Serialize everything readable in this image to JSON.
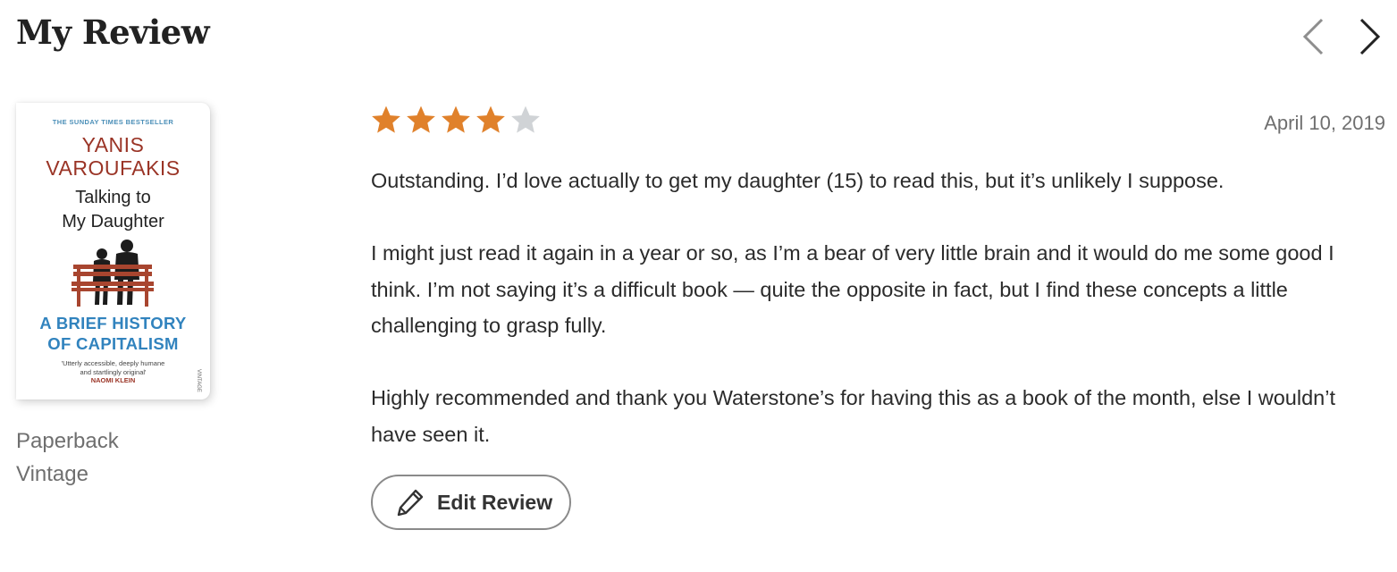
{
  "section": {
    "title": "My Review"
  },
  "navigation": {
    "prev_icon": "chevron-left-icon",
    "next_icon": "chevron-right-icon"
  },
  "book": {
    "cover": {
      "bestseller_line": "THE SUNDAY TIMES BESTSELLER",
      "author_line1": "YANIS",
      "author_line2": "VAROUFAKIS",
      "title_line1": "Talking to",
      "title_line2": "My Daughter",
      "subtitle_line1": "A BRIEF HISTORY",
      "subtitle_line2": "OF CAPITALISM",
      "quote_line1": "'Utterly accessible, deeply humane",
      "quote_line2": "and startlingly original'",
      "quote_author": "NAOMI KLEIN",
      "publisher_mark": "VINTAGE"
    },
    "format": "Paperback",
    "publisher": "Vintage"
  },
  "review": {
    "rating": 4,
    "max_rating": 5,
    "colors": {
      "star_filled": "#e0812b",
      "star_empty": "#d0d3d6"
    },
    "date": "April 10, 2019",
    "paragraphs": [
      "Outstanding. I’d love actually to get my daughter (15) to read this, but it’s unlikely I suppose.",
      "I might just read it again in a year or so, as I’m a bear of very little brain and it would do me some good I think. I’m not saying it’s a difficult book — quite the opposite in fact, but I find these concepts a little challenging to grasp fully.",
      "Highly recommended and thank you Waterstone’s for having this as a book of the month, else I wouldn’t have seen it."
    ],
    "edit_button": {
      "label": "Edit Review",
      "icon": "pencil-icon"
    }
  }
}
